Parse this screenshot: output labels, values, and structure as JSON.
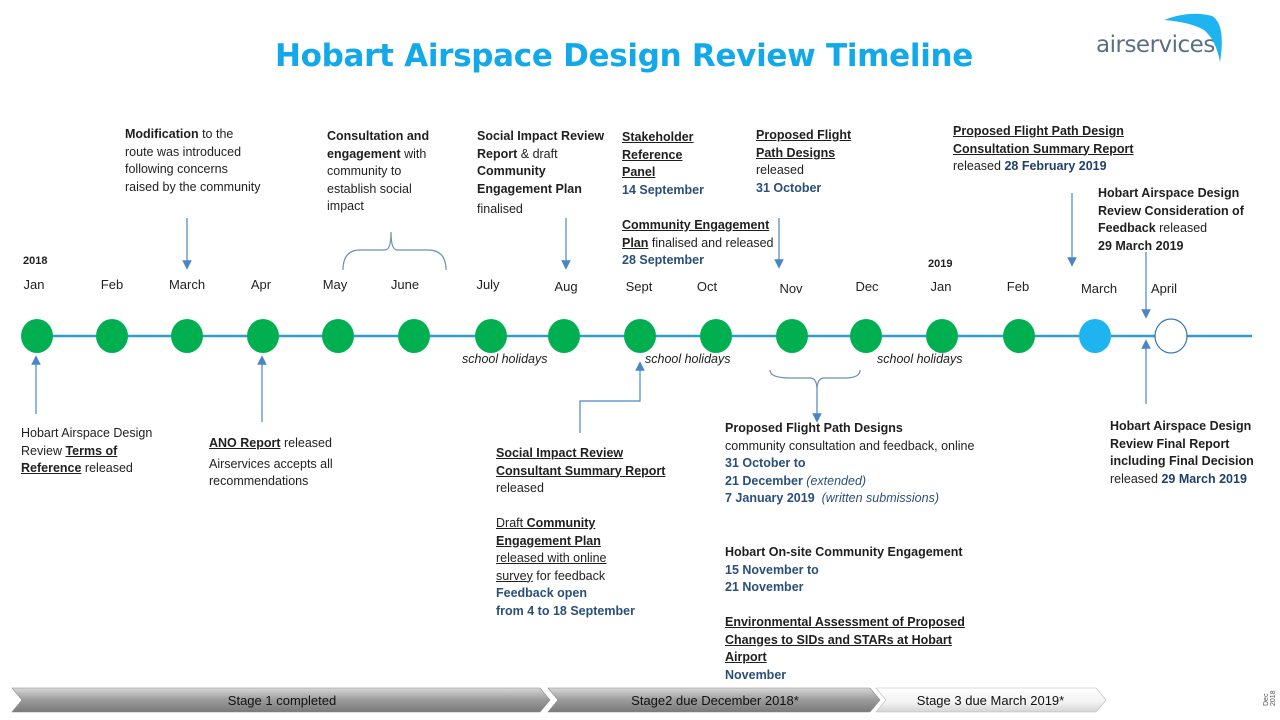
{
  "title": "Hobart Airspace Design Review Timeline",
  "logo": {
    "text": "airservices",
    "icon": "boomerang-logo-icon"
  },
  "years": [
    "2018",
    "2019"
  ],
  "months": [
    "Jan",
    "Feb",
    "March",
    "Apr",
    "May",
    "June",
    "July",
    "Aug",
    "Sept",
    "Oct",
    "Nov",
    "Dec",
    "Jan",
    "Feb",
    "March",
    "April"
  ],
  "node_states": [
    "completed",
    "completed",
    "completed",
    "completed",
    "completed",
    "completed",
    "completed",
    "completed",
    "completed",
    "completed",
    "completed",
    "completed",
    "completed",
    "completed",
    "current",
    "upcoming"
  ],
  "colors": {
    "completed": "#00b050",
    "current": "#1eb4f0",
    "upcoming": "#ffffff",
    "line": "#2e9ccf",
    "title": "#13a8e8",
    "date": "#2a4f7a"
  },
  "school_holidays": [
    "school holidays",
    "school holidays",
    "school holidays"
  ],
  "above": {
    "modification": {
      "bold": "Modification",
      "rest": " to the route was introduced following concerns raised by the community"
    },
    "consultation": {
      "bold": "Consultation and engagement",
      "rest": " with community to establish social impact"
    },
    "social_impact": {
      "b1": "Social Impact Review Report",
      "t1": " & draft ",
      "b2": "Community Engagement Plan",
      "t2": "finalised"
    },
    "stakeholder": {
      "title": "Stakeholder Reference Panel",
      "date": "14 September"
    },
    "cep": {
      "title": "Community Engagement Plan",
      "rest": " finalised and released ",
      "date": "28 September"
    },
    "pfpd": {
      "title": "Proposed Flight Path Designs",
      "rest": "released",
      "date": "31 October"
    },
    "summary_report": {
      "title": "Proposed Flight Path Design Consultation Summary Report",
      "rest": "released ",
      "date": "28 February 2019"
    },
    "consideration": {
      "bold1": "Hobart Airspace Design Review Consideration of Feedback",
      "rest": " released",
      "date": "29 March 2019"
    }
  },
  "below": {
    "tor": {
      "t1": "Hobart Airspace Design Review ",
      "link": "Terms of Reference",
      "t2": " released"
    },
    "ano": {
      "title": "ANO Report",
      "rest": " released",
      "line2": "Airservices accepts all recommendations"
    },
    "sir_consultant": {
      "title": "Social Impact Review Consultant Summary Report",
      "rest": "released"
    },
    "draft_cep": {
      "t1": "Draft ",
      "b1": "Community Engagement Plan",
      "u1": "released with online survey",
      "t2": " for feedback",
      "d1": "Feedback open",
      "d2": "from 4 to 18 September"
    },
    "pfpd_consult": {
      "title": "Proposed Flight Path Designs",
      "line": "community consultation and feedback, online",
      "d1": "31 October to",
      "d2": "21 December",
      "d2note": " (extended)",
      "d3": "7 January 2019",
      "d3note": "  (written submissions)"
    },
    "onsite": {
      "title": "Hobart On-site Community Engagement",
      "d1": "15 November to",
      "d2": "21 November"
    },
    "env": {
      "title": "Environmental Assessment of Proposed Changes to SIDs and STARs at Hobart Airport",
      "date": "November"
    },
    "final": {
      "title": "Hobart Airspace Design Review Final Report including Final Decision",
      "rest": "released ",
      "date": "29 March 2019"
    }
  },
  "stages": [
    {
      "label": "Stage 1 completed",
      "status": "completed"
    },
    {
      "label": "Stage2 due December 2018*",
      "status": "completed"
    },
    {
      "label": "Stage 3 due March 2019*",
      "status": "upcoming"
    }
  ],
  "footer_date": "Dec 2018"
}
